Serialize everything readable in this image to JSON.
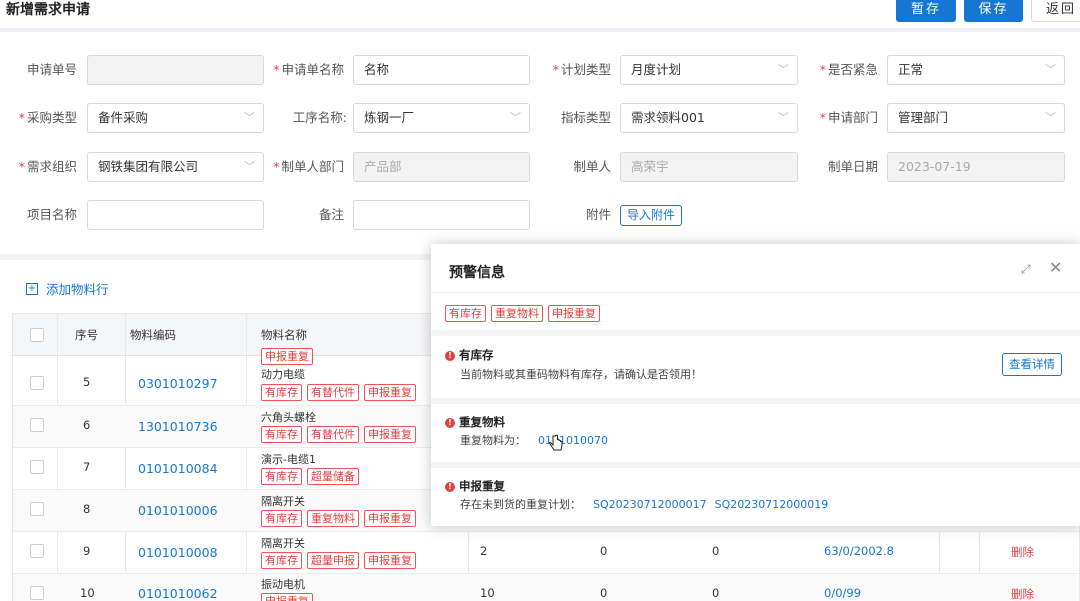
{
  "header": {
    "title": "新增需求申请",
    "save_draft": "暂存",
    "save": "保存",
    "back": "返回"
  },
  "form": {
    "request_no": {
      "label": "申请单号",
      "value": ""
    },
    "request_name": {
      "label": "申请单名称",
      "value": "名称",
      "required": true
    },
    "plan_type": {
      "label": "计划类型",
      "value": "月度计划",
      "required": true
    },
    "urgent": {
      "label": "是否紧急",
      "value": "正常",
      "required": true
    },
    "purchase_type": {
      "label": "采购类型",
      "value": "备件采购",
      "required": true
    },
    "process_name": {
      "label": "工序名称:",
      "value": "炼钢一厂"
    },
    "indicator_type": {
      "label": "指标类型",
      "value": "需求领料001"
    },
    "apply_dept": {
      "label": "申请部门",
      "value": "管理部门",
      "required": true
    },
    "demand_org": {
      "label": "需求组织",
      "value": "钢铁集团有限公司",
      "required": true
    },
    "maker_dept": {
      "label": "制单人部门",
      "value": "产品部",
      "required": true
    },
    "maker": {
      "label": "制单人",
      "value": "高荣宇"
    },
    "make_date": {
      "label": "制单日期",
      "value": "2023-07-19"
    },
    "project_name": {
      "label": "项目名称",
      "value": ""
    },
    "remark": {
      "label": "备注",
      "value": ""
    },
    "attachment": {
      "label": "附件",
      "button": "导入附件"
    }
  },
  "table": {
    "add_row": "添加物料行",
    "columns": {
      "seq": "序号",
      "code": "物料编码",
      "name": "物料名称"
    },
    "top_partial_tag": "申报重复",
    "rows": [
      {
        "seq": "5",
        "code": "0301010297",
        "name": "动力电缆",
        "tags": [
          "有库存",
          "有替代件",
          "申报重复"
        ]
      },
      {
        "seq": "6",
        "code": "1301010736",
        "name": "六角头螺栓",
        "tags": [
          "有库存",
          "有替代件",
          "申报重复"
        ]
      },
      {
        "seq": "7",
        "code": "0101010084",
        "name": "演示-电缆1",
        "tags": [
          "有库存",
          "超量储备"
        ]
      },
      {
        "seq": "8",
        "code": "0101010006",
        "name": "隔离开关",
        "tags": [
          "有库存",
          "重复物料",
          "申报重复"
        ]
      },
      {
        "seq": "9",
        "code": "0101010008",
        "name": "隔离开关",
        "tags": [
          "有库存",
          "超量申报",
          "申报重复"
        ],
        "qty": "2",
        "c1": "0",
        "c2": "0",
        "link": "63/0/2002.8",
        "action": "删除"
      },
      {
        "seq": "10",
        "code": "0101010062",
        "name": "振动电机",
        "tags": [
          "申报重复"
        ],
        "qty": "10",
        "c1": "0",
        "c2": "0",
        "link": "0/0/99",
        "action": "删除"
      }
    ]
  },
  "warning_dialog": {
    "title": "预警信息",
    "summary_tags": [
      "有库存",
      "重复物料",
      "申报重复"
    ],
    "items": [
      {
        "title": "有库存",
        "desc": "当前物料或其重码物料有库存，请确认是否领用！",
        "button": "查看详情"
      },
      {
        "title": "重复物料",
        "desc": "重复物料为：",
        "link": "0101010070"
      },
      {
        "title": "申报重复",
        "desc": "存在未到货的重复计划：",
        "links": [
          "SQ20230712000017",
          "SQ20230712000019"
        ]
      }
    ]
  },
  "colors": {
    "primary": "#1677d2",
    "danger": "#e04040"
  }
}
